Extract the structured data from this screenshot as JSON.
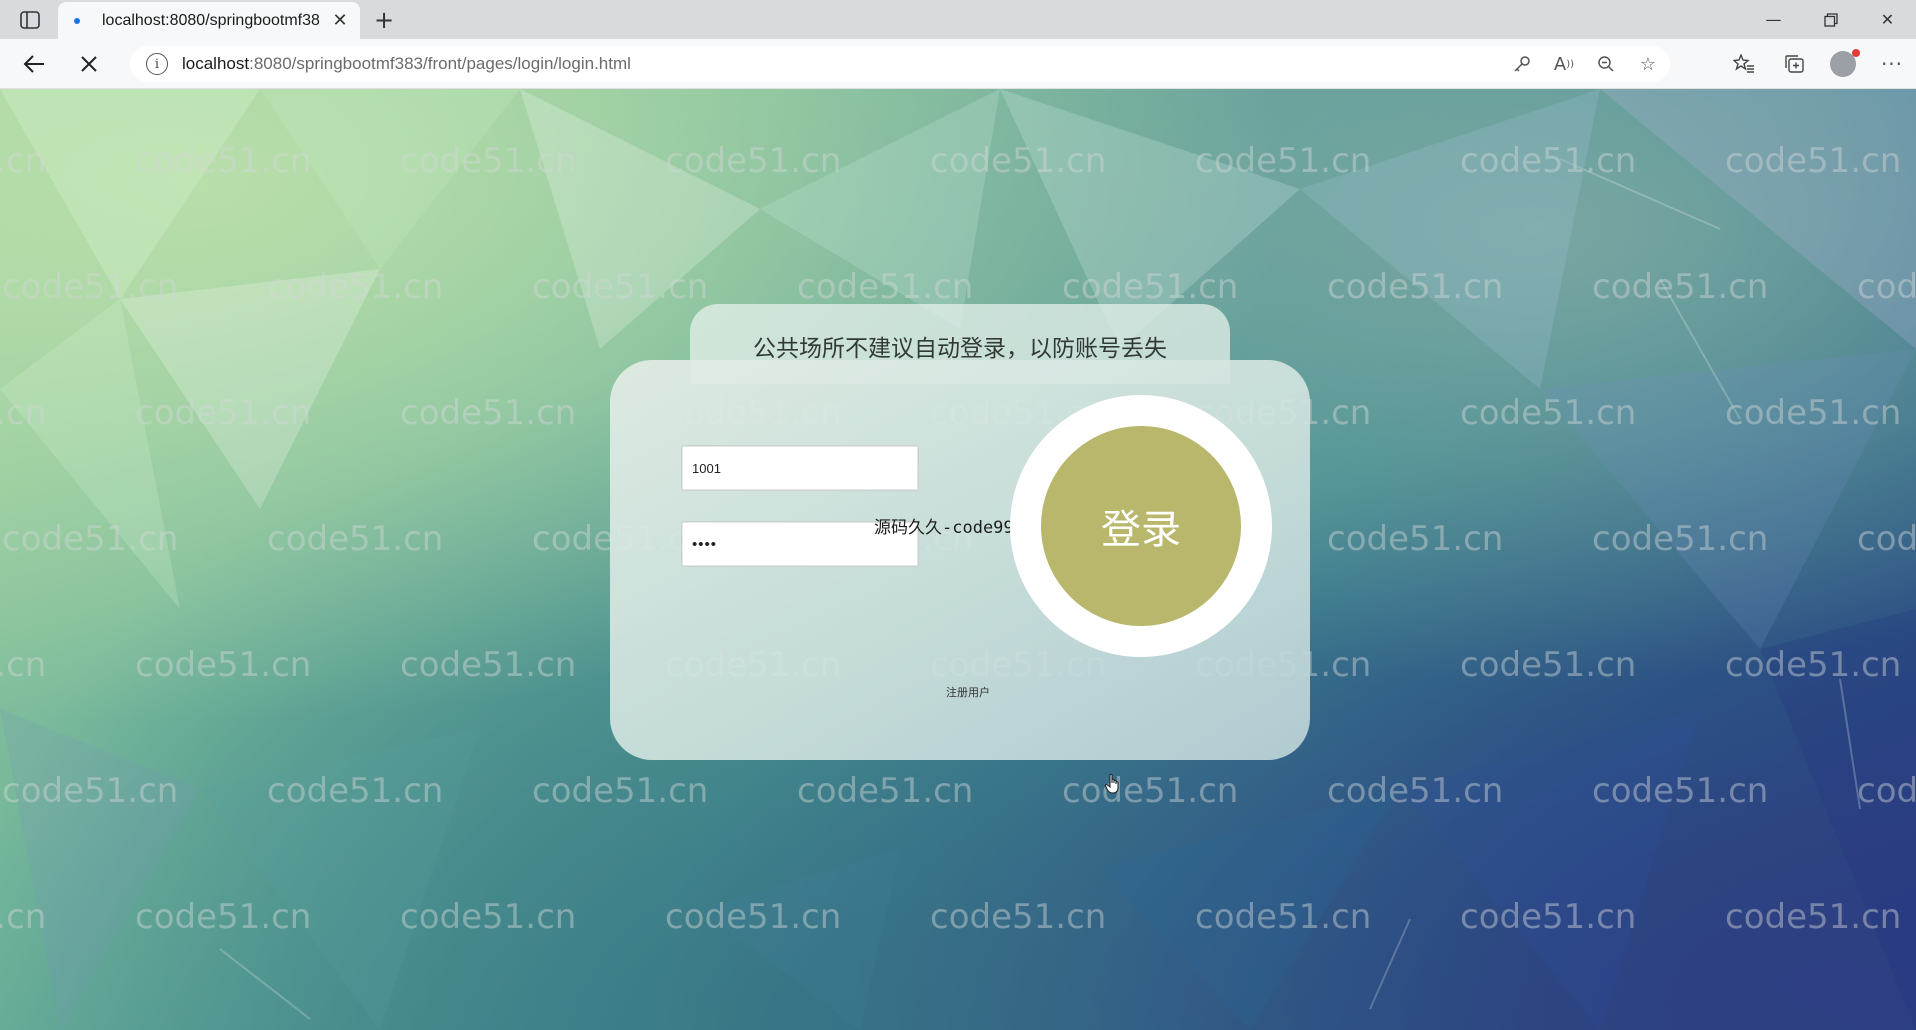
{
  "browser": {
    "tab_title": "localhost:8080/springbootmf383",
    "url_host": "localhost",
    "url_path": ":8080/springbootmf383/front/pages/login/login.html"
  },
  "page": {
    "watermark_text": "code51.cn",
    "notice": "公共场所不建议自动登录，以防账号丢失",
    "username_value": "1001",
    "password_value": "••••",
    "promo_text": "源码久久-code99.top",
    "login_button_label": "登录",
    "register_label": "注册用户"
  },
  "colors": {
    "login_button": "#b8b76c",
    "tab_favicon": "#1a73e8"
  },
  "icons": {
    "tab_actions": "sidebar-icon",
    "back": "arrow-left-icon",
    "stop": "close-icon",
    "site_info": "info-icon",
    "password_key": "key-icon",
    "read_aloud": "read-aloud-icon",
    "zoom": "zoom-out-icon",
    "favorite": "star-add-icon",
    "favorites": "favorites-list-icon",
    "collections": "collections-icon",
    "profile": "avatar",
    "menu": "more-icon"
  }
}
